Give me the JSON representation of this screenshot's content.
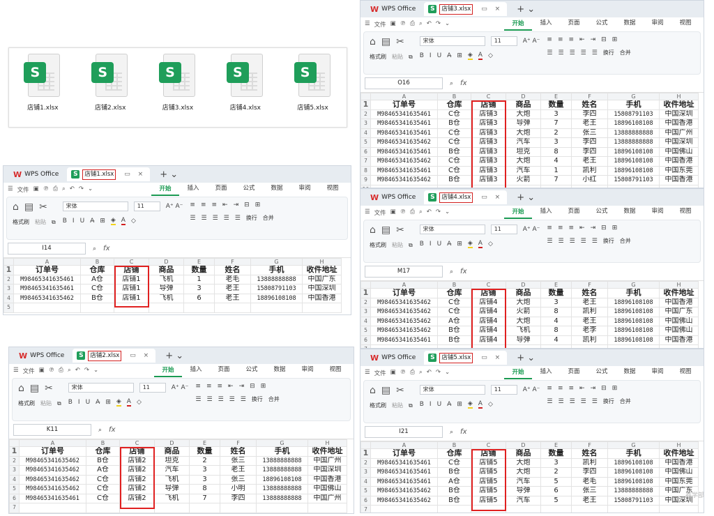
{
  "files": [
    "店铺1.xlsx",
    "店铺2.xlsx",
    "店铺3.xlsx",
    "店铺4.xlsx",
    "店铺5.xlsx"
  ],
  "ui": {
    "app_name": "WPS Office",
    "menu_file": "文件",
    "tabs": [
      "开始",
      "插入",
      "页面",
      "公式",
      "数据",
      "审阅",
      "视图"
    ],
    "ribbon": {
      "format_painter": "格式刷",
      "paste": "粘贴",
      "font": "宋体",
      "size": "11",
      "wrap": "换行",
      "merge": "合并"
    },
    "fx": "fx",
    "col_letters": [
      "A",
      "B",
      "C",
      "D",
      "E",
      "F",
      "G",
      "H"
    ]
  },
  "windows": [
    {
      "id": "w1",
      "tab": "店铺1.xlsx",
      "cell": "I14",
      "header": [
        "订单号",
        "仓库",
        "店铺",
        "商品",
        "数量",
        "姓名",
        "手机",
        "收件地址"
      ],
      "rows": [
        [
          "M98465341635461",
          "A仓",
          "店铺1",
          "飞机",
          "1",
          "老毛",
          "13888888888",
          "中国广东"
        ],
        [
          "M98465341635461",
          "C仓",
          "店铺1",
          "导弹",
          "3",
          "老王",
          "15808791103",
          "中国深圳"
        ],
        [
          "M98465341635462",
          "B仓",
          "店铺1",
          "飞机",
          "6",
          "老王",
          "18896108108",
          "中国香港"
        ]
      ]
    },
    {
      "id": "w2",
      "tab": "店铺2.xlsx",
      "cell": "K11",
      "header": [
        "订单号",
        "仓库",
        "店铺",
        "商品",
        "数量",
        "姓名",
        "手机",
        "收件地址"
      ],
      "rows": [
        [
          "M98465341635462",
          "B仓",
          "店铺2",
          "坦克",
          "2",
          "张三",
          "13888888888",
          "中国广州"
        ],
        [
          "M98465341635462",
          "A仓",
          "店铺2",
          "汽车",
          "3",
          "老王",
          "13888888888",
          "中国深圳"
        ],
        [
          "M98465341635462",
          "C仓",
          "店铺2",
          "飞机",
          "3",
          "张三",
          "18896108108",
          "中国香港"
        ],
        [
          "M98465341635462",
          "C仓",
          "店铺2",
          "导弹",
          "8",
          "小明",
          "13888888888",
          "中国佛山"
        ],
        [
          "M98465341635461",
          "C仓",
          "店铺2",
          "飞机",
          "7",
          "李四",
          "13888888888",
          "中国广州"
        ]
      ]
    },
    {
      "id": "w3",
      "tab": "店铺3.xlsx",
      "cell": "O16",
      "header": [
        "订单号",
        "仓库",
        "店铺",
        "商品",
        "数量",
        "姓名",
        "手机",
        "收件地址"
      ],
      "rows": [
        [
          "M98465341635461",
          "C仓",
          "店铺3",
          "大炮",
          "3",
          "李四",
          "15808791103",
          "中国深圳"
        ],
        [
          "M98465341635461",
          "B仓",
          "店铺3",
          "导弹",
          "7",
          "老王",
          "18896108108",
          "中国香港"
        ],
        [
          "M98465341635461",
          "C仓",
          "店铺3",
          "大炮",
          "2",
          "张三",
          "13888888888",
          "中国广州"
        ],
        [
          "M98465341635462",
          "C仓",
          "店铺3",
          "汽车",
          "3",
          "李四",
          "13888888888",
          "中国深圳"
        ],
        [
          "M98465341635461",
          "B仓",
          "店铺3",
          "坦克",
          "8",
          "李四",
          "18896108108",
          "中国佛山"
        ],
        [
          "M98465341635462",
          "C仓",
          "店铺3",
          "大炮",
          "4",
          "老王",
          "18896108108",
          "中国香港"
        ],
        [
          "M98465341635461",
          "C仓",
          "店铺3",
          "汽车",
          "1",
          "凯利",
          "18896108108",
          "中国东莞"
        ],
        [
          "M98465341635462",
          "B仓",
          "店铺3",
          "火箭",
          "7",
          "小红",
          "15808791103",
          "中国香港"
        ]
      ]
    },
    {
      "id": "w4",
      "tab": "店铺4.xlsx",
      "cell": "M17",
      "header": [
        "订单号",
        "仓库",
        "店铺",
        "商品",
        "数量",
        "姓名",
        "手机",
        "收件地址"
      ],
      "rows": [
        [
          "M98465341635462",
          "C仓",
          "店铺4",
          "大炮",
          "3",
          "老王",
          "18896108108",
          "中国香港"
        ],
        [
          "M98465341635462",
          "C仓",
          "店铺4",
          "火箭",
          "8",
          "凯利",
          "18896108108",
          "中国广东"
        ],
        [
          "M98465341635462",
          "A仓",
          "店铺4",
          "大炮",
          "4",
          "老王",
          "18896108108",
          "中国佛山"
        ],
        [
          "M98465341635462",
          "B仓",
          "店铺4",
          "飞机",
          "8",
          "老李",
          "18896108108",
          "中国佛山"
        ],
        [
          "M98465341635461",
          "B仓",
          "店铺4",
          "导弹",
          "4",
          "凯利",
          "18896108108",
          "中国香港"
        ]
      ]
    },
    {
      "id": "w5",
      "tab": "店铺5.xlsx",
      "cell": "I21",
      "header": [
        "订单号",
        "仓库",
        "店铺",
        "商品",
        "数量",
        "姓名",
        "手机",
        "收件地址"
      ],
      "rows": [
        [
          "M98465341635461",
          "C仓",
          "店铺5",
          "大炮",
          "3",
          "凯利",
          "18896108108",
          "中国香港"
        ],
        [
          "M98465341635461",
          "B仓",
          "店铺5",
          "大炮",
          "2",
          "李四",
          "18896108108",
          "中国佛山"
        ],
        [
          "M98465341635461",
          "A仓",
          "店铺5",
          "汽车",
          "5",
          "老毛",
          "18896108108",
          "中国东莞"
        ],
        [
          "M98465341635462",
          "B仓",
          "店铺5",
          "导弹",
          "6",
          "张三",
          "13888888888",
          "中国广东"
        ],
        [
          "M98465341635462",
          "B仓",
          "店铺5",
          "汽车",
          "5",
          "老王",
          "15808791103",
          "中国深圳"
        ]
      ]
    }
  ],
  "watermark": "鑫学部"
}
